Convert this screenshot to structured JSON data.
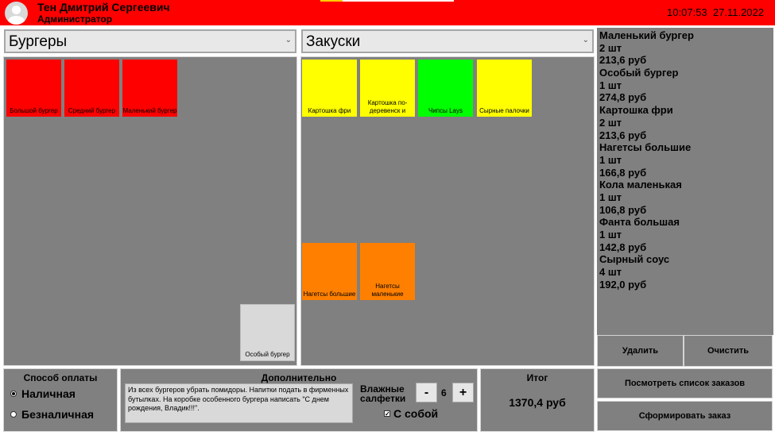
{
  "header": {
    "user_name": "Тен Дмитрий Сергеевич",
    "user_role": "Администратор",
    "time": "10:07:53",
    "date": "27.11.2022"
  },
  "menu_left": {
    "category": "Бургеры",
    "items": [
      "Большой бургер",
      "Средний бургер",
      "Маленький бургер",
      "Особый бургер"
    ]
  },
  "menu_right": {
    "category": "Закуски",
    "items": [
      "Картошка фри",
      "Картошка по-деревенск и",
      "Чипсы Lays",
      "Сырные палочки",
      "Нагетсы большие",
      "Нагетсы маленькие"
    ]
  },
  "order": {
    "items": [
      {
        "name": "Маленький бургер",
        "qty": "2 шт",
        "price": "213,6 руб"
      },
      {
        "name": "Особый бургер",
        "qty": "1 шт",
        "price": "274,8 руб"
      },
      {
        "name": "Картошка фри",
        "qty": "2 шт",
        "price": "213,6 руб"
      },
      {
        "name": "Нагетсы большие",
        "qty": "1 шт",
        "price": "166,8 руб"
      },
      {
        "name": "Кола маленькая",
        "qty": "1 шт",
        "price": "106,8 руб"
      },
      {
        "name": "Фанта большая",
        "qty": "1 шт",
        "price": "142,8 руб"
      },
      {
        "name": "Сырный соус",
        "qty": "4 шт",
        "price": "192,0 руб"
      }
    ],
    "delete_label": "Удалить",
    "clear_label": "Очистить"
  },
  "payment": {
    "title": "Способ оплаты",
    "cash_label": "Наличная",
    "cashless_label": "Безналичная"
  },
  "extra": {
    "title": "Дополнительно",
    "notes": "Из всех бургеров убрать помидоры. Напитки подать в фирменных бутылках. На коробке особенного бургера написать \"С днем рождения, Владик!!!\".",
    "wipes_label_1": "Влажные",
    "wipes_label_2": "салфетки",
    "minus": "-",
    "plus": "+",
    "wipes_count": "6",
    "takeaway_check": "✓",
    "takeaway_label": "С собой"
  },
  "total": {
    "title": "Итог",
    "value": "1370,4 руб"
  },
  "actions": {
    "view_orders": "Посмотреть список заказов",
    "place_order": "Сформировать заказ"
  },
  "colors": {
    "header": "#ff0000",
    "burger_tile": "#ff0000",
    "snack_yellow": "#ffff00",
    "snack_green": "#00ff00",
    "snack_orange": "#ff8000",
    "special_tile": "#d9d9d9",
    "panel": "#808080"
  }
}
